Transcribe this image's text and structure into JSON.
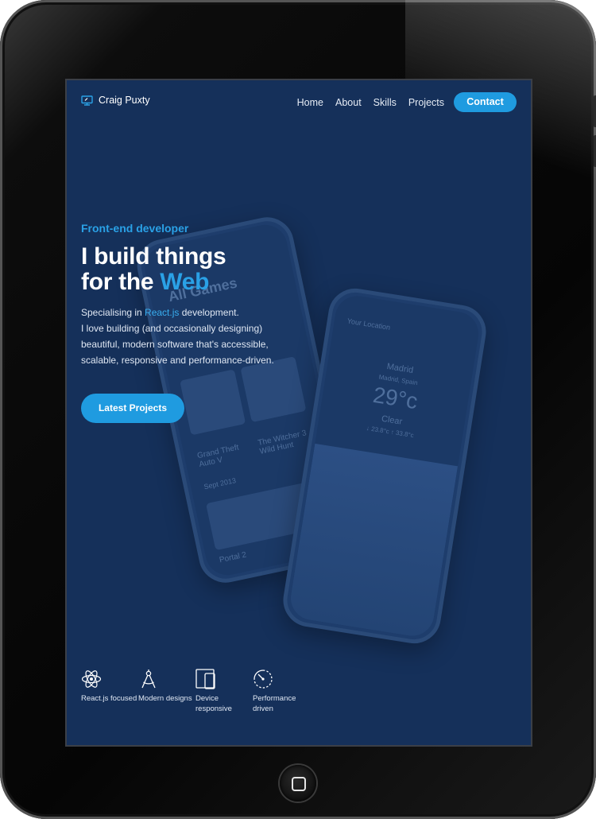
{
  "nav": {
    "logo_text": "Craig Puxty",
    "links": [
      "Home",
      "About",
      "Skills",
      "Projects"
    ],
    "contact_label": "Contact"
  },
  "hero": {
    "eyebrow": "Front-end developer",
    "headline_line1": "I build things",
    "headline_line2_prefix": "for the ",
    "headline_line2_accent": "Web",
    "desc_prefix": "Specialising in ",
    "desc_accent": "React.js",
    "desc_suffix": " development.",
    "desc_line2": "I love building (and occasionally designing) beautiful, modern software that's accessible, scalable, responsive and performance-driven.",
    "cta_label": "Latest Projects"
  },
  "phone_back": {
    "header": "All Games",
    "game1": "Grand Theft Auto V",
    "game2": "The Witcher 3 Wild Hunt",
    "game3": "Portal 2",
    "date1": "Sept 2013"
  },
  "phone_front": {
    "location_hint": "Your Location",
    "city": "Madrid",
    "country": "Madrid, Spain",
    "temp": "29°c",
    "condition": "Clear",
    "range": "↓ 23.8°c   ↑ 33.8°c"
  },
  "features": [
    {
      "icon": "react-atom-icon",
      "label": "React.js focused"
    },
    {
      "icon": "compass-icon",
      "label": "Modern designs"
    },
    {
      "icon": "devices-icon",
      "label": "Device responsive"
    },
    {
      "icon": "speedometer-icon",
      "label": "Performance driven"
    }
  ],
  "colors": {
    "background": "#15305a",
    "accent": "#1f9be0",
    "device_frame": "#050505"
  }
}
